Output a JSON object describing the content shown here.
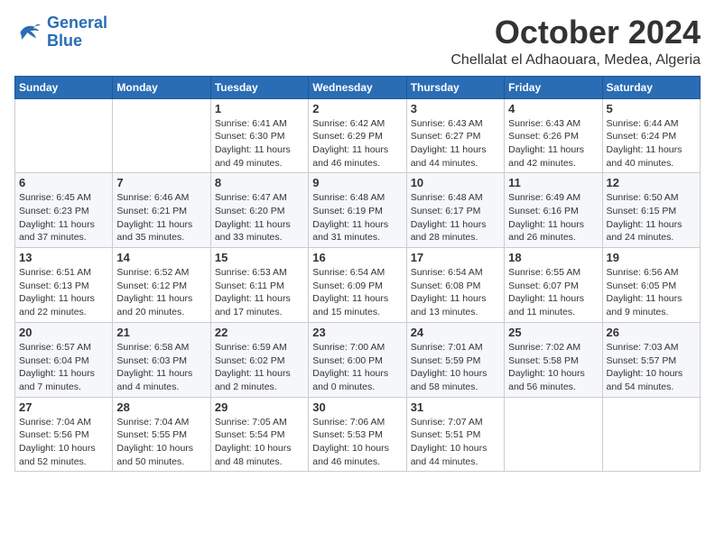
{
  "logo": {
    "line1": "General",
    "line2": "Blue"
  },
  "title": "October 2024",
  "location": "Chellalat el Adhaouara, Medea, Algeria",
  "days_of_week": [
    "Sunday",
    "Monday",
    "Tuesday",
    "Wednesday",
    "Thursday",
    "Friday",
    "Saturday"
  ],
  "weeks": [
    [
      {
        "day": "",
        "info": ""
      },
      {
        "day": "",
        "info": ""
      },
      {
        "day": "1",
        "info": "Sunrise: 6:41 AM\nSunset: 6:30 PM\nDaylight: 11 hours and 49 minutes."
      },
      {
        "day": "2",
        "info": "Sunrise: 6:42 AM\nSunset: 6:29 PM\nDaylight: 11 hours and 46 minutes."
      },
      {
        "day": "3",
        "info": "Sunrise: 6:43 AM\nSunset: 6:27 PM\nDaylight: 11 hours and 44 minutes."
      },
      {
        "day": "4",
        "info": "Sunrise: 6:43 AM\nSunset: 6:26 PM\nDaylight: 11 hours and 42 minutes."
      },
      {
        "day": "5",
        "info": "Sunrise: 6:44 AM\nSunset: 6:24 PM\nDaylight: 11 hours and 40 minutes."
      }
    ],
    [
      {
        "day": "6",
        "info": "Sunrise: 6:45 AM\nSunset: 6:23 PM\nDaylight: 11 hours and 37 minutes."
      },
      {
        "day": "7",
        "info": "Sunrise: 6:46 AM\nSunset: 6:21 PM\nDaylight: 11 hours and 35 minutes."
      },
      {
        "day": "8",
        "info": "Sunrise: 6:47 AM\nSunset: 6:20 PM\nDaylight: 11 hours and 33 minutes."
      },
      {
        "day": "9",
        "info": "Sunrise: 6:48 AM\nSunset: 6:19 PM\nDaylight: 11 hours and 31 minutes."
      },
      {
        "day": "10",
        "info": "Sunrise: 6:48 AM\nSunset: 6:17 PM\nDaylight: 11 hours and 28 minutes."
      },
      {
        "day": "11",
        "info": "Sunrise: 6:49 AM\nSunset: 6:16 PM\nDaylight: 11 hours and 26 minutes."
      },
      {
        "day": "12",
        "info": "Sunrise: 6:50 AM\nSunset: 6:15 PM\nDaylight: 11 hours and 24 minutes."
      }
    ],
    [
      {
        "day": "13",
        "info": "Sunrise: 6:51 AM\nSunset: 6:13 PM\nDaylight: 11 hours and 22 minutes."
      },
      {
        "day": "14",
        "info": "Sunrise: 6:52 AM\nSunset: 6:12 PM\nDaylight: 11 hours and 20 minutes."
      },
      {
        "day": "15",
        "info": "Sunrise: 6:53 AM\nSunset: 6:11 PM\nDaylight: 11 hours and 17 minutes."
      },
      {
        "day": "16",
        "info": "Sunrise: 6:54 AM\nSunset: 6:09 PM\nDaylight: 11 hours and 15 minutes."
      },
      {
        "day": "17",
        "info": "Sunrise: 6:54 AM\nSunset: 6:08 PM\nDaylight: 11 hours and 13 minutes."
      },
      {
        "day": "18",
        "info": "Sunrise: 6:55 AM\nSunset: 6:07 PM\nDaylight: 11 hours and 11 minutes."
      },
      {
        "day": "19",
        "info": "Sunrise: 6:56 AM\nSunset: 6:05 PM\nDaylight: 11 hours and 9 minutes."
      }
    ],
    [
      {
        "day": "20",
        "info": "Sunrise: 6:57 AM\nSunset: 6:04 PM\nDaylight: 11 hours and 7 minutes."
      },
      {
        "day": "21",
        "info": "Sunrise: 6:58 AM\nSunset: 6:03 PM\nDaylight: 11 hours and 4 minutes."
      },
      {
        "day": "22",
        "info": "Sunrise: 6:59 AM\nSunset: 6:02 PM\nDaylight: 11 hours and 2 minutes."
      },
      {
        "day": "23",
        "info": "Sunrise: 7:00 AM\nSunset: 6:00 PM\nDaylight: 11 hours and 0 minutes."
      },
      {
        "day": "24",
        "info": "Sunrise: 7:01 AM\nSunset: 5:59 PM\nDaylight: 10 hours and 58 minutes."
      },
      {
        "day": "25",
        "info": "Sunrise: 7:02 AM\nSunset: 5:58 PM\nDaylight: 10 hours and 56 minutes."
      },
      {
        "day": "26",
        "info": "Sunrise: 7:03 AM\nSunset: 5:57 PM\nDaylight: 10 hours and 54 minutes."
      }
    ],
    [
      {
        "day": "27",
        "info": "Sunrise: 7:04 AM\nSunset: 5:56 PM\nDaylight: 10 hours and 52 minutes."
      },
      {
        "day": "28",
        "info": "Sunrise: 7:04 AM\nSunset: 5:55 PM\nDaylight: 10 hours and 50 minutes."
      },
      {
        "day": "29",
        "info": "Sunrise: 7:05 AM\nSunset: 5:54 PM\nDaylight: 10 hours and 48 minutes."
      },
      {
        "day": "30",
        "info": "Sunrise: 7:06 AM\nSunset: 5:53 PM\nDaylight: 10 hours and 46 minutes."
      },
      {
        "day": "31",
        "info": "Sunrise: 7:07 AM\nSunset: 5:51 PM\nDaylight: 10 hours and 44 minutes."
      },
      {
        "day": "",
        "info": ""
      },
      {
        "day": "",
        "info": ""
      }
    ]
  ]
}
